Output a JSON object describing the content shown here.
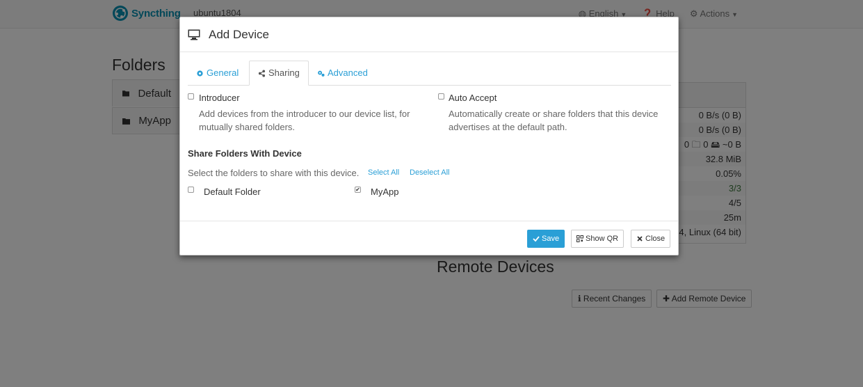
{
  "navbar": {
    "brand": "Syncthing",
    "hostname": "ubuntu1804",
    "language": "English",
    "help": "Help",
    "actions": "Actions"
  },
  "folders": {
    "heading": "Folders",
    "items": [
      "Default",
      "MyApp"
    ]
  },
  "this_device": {
    "rows": [
      "0 B/s (0 B)",
      "0 B/s (0 B)",
      "0   🗀 0   🖴 ~0 B",
      "32.8 MiB",
      "0.05%",
      "3/3",
      "4/5",
      "25m",
      "4, Linux (64 bit)"
    ]
  },
  "remote_devices": {
    "heading": "Remote Devices",
    "recent_changes": "Recent Changes",
    "add_remote_device": "Add Remote Device"
  },
  "modal": {
    "title": "Add Device",
    "tabs": {
      "general": "General",
      "sharing": "Sharing",
      "advanced": "Advanced"
    },
    "introducer": {
      "label": "Introducer",
      "checked": false,
      "help_line1": "Add devices from the introducer to our device list, for",
      "help_line2": "mutually shared folders."
    },
    "auto_accept": {
      "label": "Auto Accept",
      "checked": false,
      "help_line1": "Automatically create or share folders that this device",
      "help_line2": "advertises at the default path."
    },
    "share": {
      "title": "Share Folders With Device",
      "help": "Select the folders to share with this device.",
      "select_all": "Select All",
      "deselect_all": "Deselect All",
      "folders": [
        {
          "label": "Default Folder",
          "checked": false
        },
        {
          "label": "MyApp",
          "checked": true
        }
      ]
    },
    "footer": {
      "save": "Save",
      "show_qr": "Show QR",
      "close": "Close"
    }
  },
  "colors": {
    "accent": "#2a9fd6",
    "brand": "#0891b2",
    "green": "#3c763d"
  }
}
